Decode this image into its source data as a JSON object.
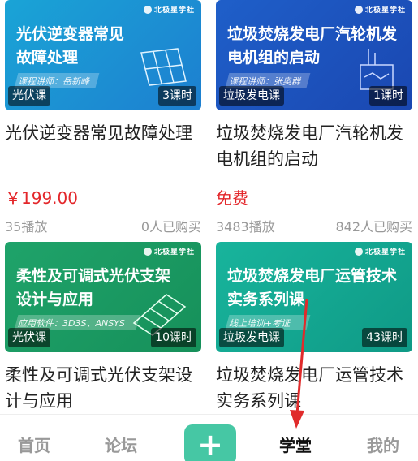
{
  "courses": [
    {
      "thumb_title": "光伏逆变器常见故障处理",
      "thumb_sub": "课程讲师：岳新峰",
      "brand": "北极星学社",
      "category": "光伏课",
      "duration": "3课时",
      "title": "光伏逆变器常见故障处理",
      "price": "￥199.00",
      "plays": "35播放",
      "purchases": "0人已购买"
    },
    {
      "thumb_title": "垃圾焚烧发电厂汽轮机发电机组的启动",
      "thumb_sub": "课程讲师：张奥群",
      "brand": "北极星学社",
      "category": "垃圾发电课",
      "duration": "1课时",
      "title": "垃圾焚烧发电厂汽轮机发电机组的启动",
      "price": "免费",
      "plays": "3483播放",
      "purchases": "842人已购买"
    },
    {
      "thumb_title": "柔性及可调式光伏支架设计与应用",
      "thumb_sub": "应用软件：3D3S、ANSYS",
      "brand": "北极星学社",
      "category": "光伏课",
      "duration": "10课时",
      "title": "柔性及可调式光伏支架设计与应用"
    },
    {
      "thumb_title": "垃圾焚烧发电厂运管技术实务系列课",
      "thumb_sub": "线上培训+考证",
      "brand": "北极星学社",
      "category": "垃圾发电课",
      "duration": "43课时",
      "title": "垃圾焚烧发电厂运管技术实务系列课"
    }
  ],
  "tabbar": {
    "home": "首页",
    "forum": "论坛",
    "add": "+",
    "study": "学堂",
    "mine": "我的"
  },
  "colors": {
    "price_red": "#e3262a",
    "accent_green": "#46c7a4",
    "annotation_arrow": "#e02b2b"
  }
}
